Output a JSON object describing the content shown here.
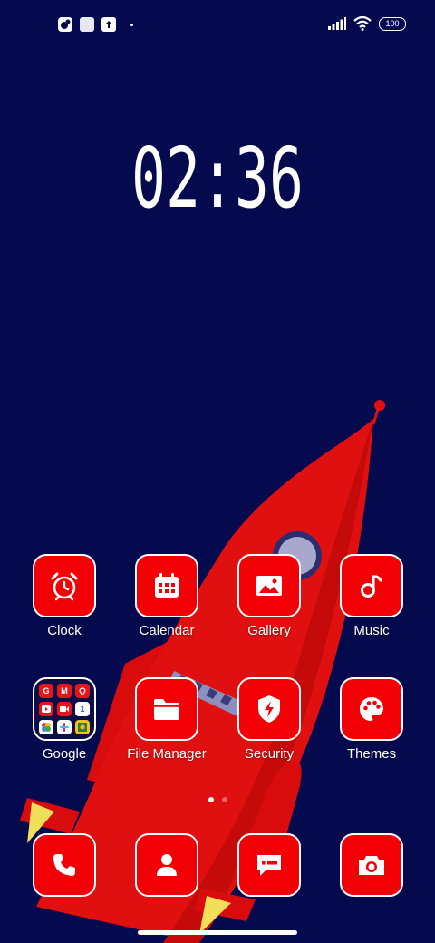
{
  "status_bar": {
    "battery": "100",
    "left_icons": [
      "app-notification-icon",
      "square-notification-icon",
      "upload-notification-icon"
    ],
    "right_icons": [
      "signal-bars-icon",
      "wifi-icon",
      "battery-icon"
    ]
  },
  "clock": {
    "time": "02:36"
  },
  "colors": {
    "background": "#050a4e",
    "tile": "#f20006",
    "tile_border": "#ffffff",
    "rocket": "#e01010"
  },
  "apps_row1": [
    {
      "label": "Clock",
      "icon": "alarm-clock-icon"
    },
    {
      "label": "Calendar",
      "icon": "calendar-icon"
    },
    {
      "label": "Gallery",
      "icon": "image-icon"
    },
    {
      "label": "Music",
      "icon": "music-note-icon"
    }
  ],
  "apps_row2": [
    {
      "label": "Google",
      "icon": "folder-grid-icon"
    },
    {
      "label": "File Manager",
      "icon": "folder-icon"
    },
    {
      "label": "Security",
      "icon": "shield-bolt-icon"
    },
    {
      "label": "Themes",
      "icon": "palette-icon"
    }
  ],
  "google_folder": {
    "letters": [
      "G",
      "M",
      "",
      "",
      "",
      "1",
      "",
      "",
      ""
    ]
  },
  "dock": [
    {
      "icon": "phone-icon"
    },
    {
      "icon": "contacts-icon"
    },
    {
      "icon": "message-icon"
    },
    {
      "icon": "camera-icon"
    }
  ],
  "page_indicator": {
    "count": 2,
    "active": 1
  }
}
